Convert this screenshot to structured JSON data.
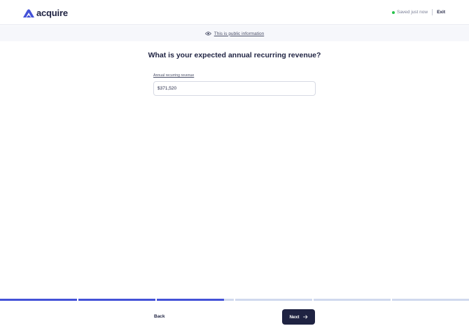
{
  "header": {
    "logo_text": "acquire",
    "saved_status": "Saved just now",
    "exit_label": "Exit"
  },
  "public_notice": {
    "text": "This is public information",
    "icon": "eye-icon"
  },
  "form": {
    "question": "What is your expected annual recurring revenue?",
    "field_label": "Annual recurring revenue",
    "field_value": "$371,520"
  },
  "progress": {
    "total_steps": 6,
    "current_step_progress": 2.87
  },
  "footer": {
    "back_label": "Back",
    "next_label": "Next"
  },
  "colors": {
    "brand": "#4452d8",
    "navy": "#1f2342",
    "saved_dot": "#27c24c",
    "track": "#d0d9ee"
  }
}
